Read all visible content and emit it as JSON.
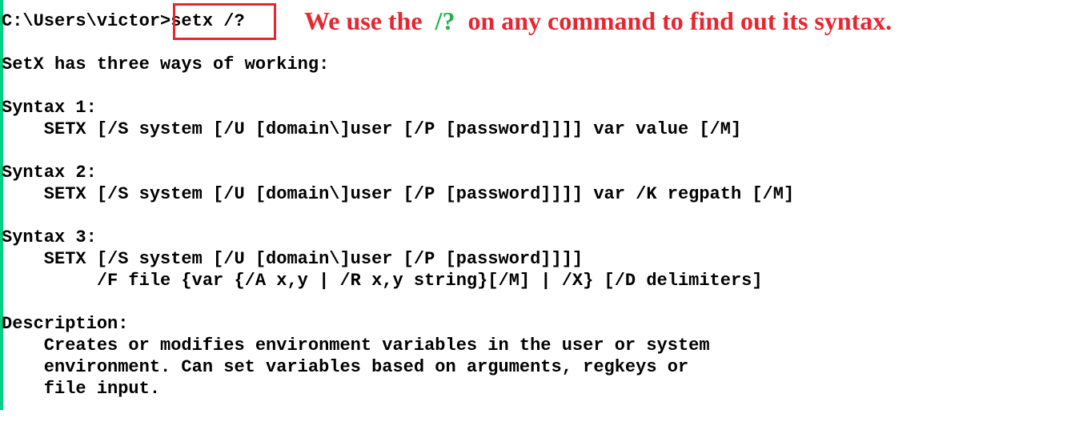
{
  "console": {
    "prompt": "C:\\Users\\victor>",
    "command": "setx /?",
    "lines": [
      "SetX has three ways of working:",
      "Syntax 1:",
      "    SETX [/S system [/U [domain\\]user [/P [password]]]] var value [/M]",
      "Syntax 2:",
      "    SETX [/S system [/U [domain\\]user [/P [password]]]] var /K regpath [/M]",
      "Syntax 3:",
      "    SETX [/S system [/U [domain\\]user [/P [password]]]]",
      "         /F file {var {/A x,y | /R x,y string}[/M] | /X} [/D delimiters]",
      "Description:",
      "    Creates or modifies environment variables in the user or system",
      "    environment. Can set variables based on arguments, regkeys or",
      "    file input."
    ]
  },
  "annotation": {
    "part1": "We use the  ",
    "flag": "/?",
    "part2": "  on any command to find out its syntax."
  },
  "colors": {
    "accent_bar": "#00d084",
    "highlight_box": "#e8262f",
    "annotation_text": "#e8262f",
    "annotation_flag": "#22b14c"
  }
}
